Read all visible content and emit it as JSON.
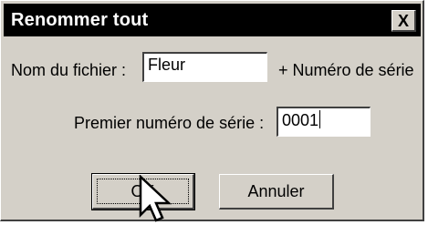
{
  "window": {
    "title": "Renommer tout",
    "close_glyph": "X"
  },
  "form": {
    "filename_label": "Nom du fichier :",
    "filename_value": "Fleur",
    "suffix_label": "+ Numéro de série",
    "first_number_label": "Premier numéro de série :",
    "first_number_value": "0001"
  },
  "buttons": {
    "ok_label": "OK",
    "cancel_label": "Annuler"
  },
  "pointer": {
    "icon": "arrow-cursor-icon"
  }
}
